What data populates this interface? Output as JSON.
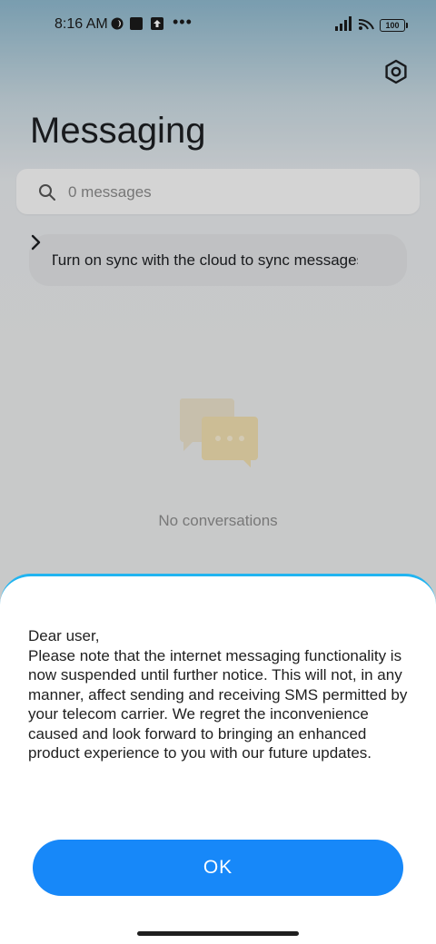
{
  "status_bar": {
    "time": "8:16 AM",
    "battery": "100",
    "more": "•••"
  },
  "app": {
    "title": "Messaging"
  },
  "search": {
    "placeholder": "0 messages"
  },
  "sync_banner": {
    "text": "Turn on sync with the cloud to sync messages"
  },
  "empty_state": {
    "text": "No conversations"
  },
  "dialog": {
    "message": "Dear user,\nPlease note that the internet messaging functionality is now suspended until further notice. This will not, in any manner, affect sending and receiving SMS permitted by your telecom carrier. We regret the inconvenience caused and look forward to bringing an enhanced product experience to you with our future updates.",
    "ok_label": "OK",
    "accent_color": "#1788f9"
  },
  "icons": [
    "moon-icon",
    "square-icon",
    "upload-icon",
    "signal-icon",
    "wifi-icon",
    "battery-icon",
    "settings-icon",
    "search-icon",
    "chevron-right-icon",
    "chat-bubbles-icon"
  ]
}
